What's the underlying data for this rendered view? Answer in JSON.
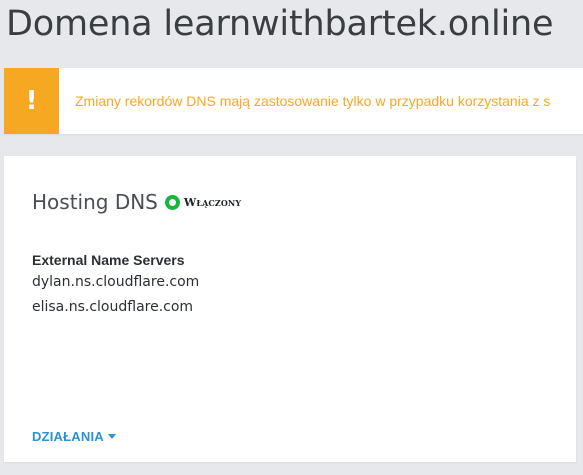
{
  "page": {
    "title": "Domena learnwithbartek.online"
  },
  "alert": {
    "icon": "exclamation-icon",
    "icon_glyph": "!",
    "message": "Zmiany rekordów DNS mają zastosowanie tylko w przypadku korzystania z s",
    "colors": {
      "accent": "#f7a823"
    }
  },
  "dns_card": {
    "title": "Hosting DNS",
    "status": {
      "label": "Włączony",
      "color": "#14b83c"
    },
    "name_servers": {
      "heading": "External Name Servers",
      "items": [
        "dylan.ns.cloudflare.com",
        "elisa.ns.cloudflare.com"
      ]
    },
    "actions": {
      "label": "DZIAŁANIA",
      "icon": "caret-down-icon",
      "color": "#2a93d5"
    }
  }
}
